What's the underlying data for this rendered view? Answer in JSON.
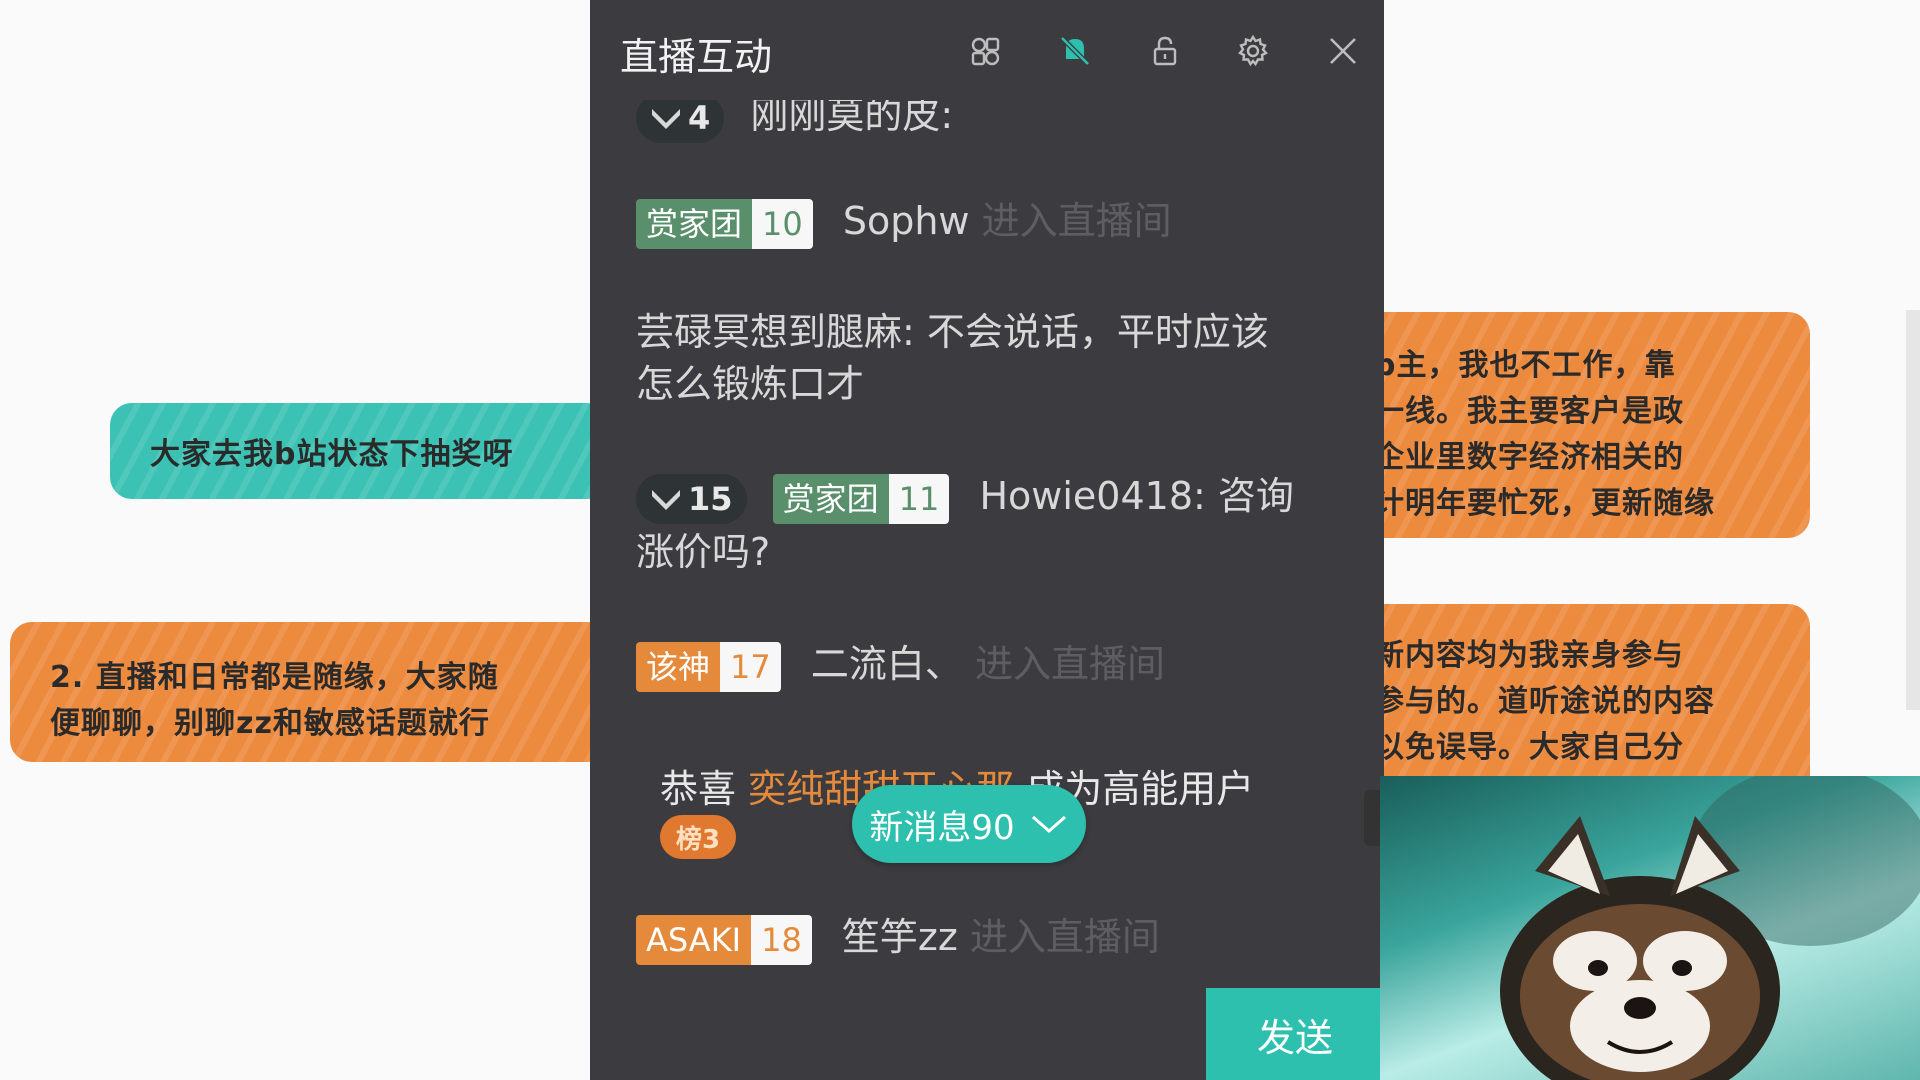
{
  "panel": {
    "title": "直播互动",
    "toolbar": [
      "layout-icon",
      "bell-off-icon",
      "lock-icon",
      "settings-icon",
      "close-icon"
    ],
    "messages": {
      "m0": {
        "fan_level": "4",
        "text": "刚刚莫的皮:"
      },
      "m1": {
        "badge_name": "赏家团",
        "badge_level": "10",
        "user": "Sophw",
        "action": "进入直播间"
      },
      "m2": {
        "line1": "芸碌冥想到腿麻: 不会说话，平时应该",
        "line2": "怎么锻炼口才"
      },
      "m3": {
        "fan_level": "15",
        "badge_name": "赏家团",
        "badge_level": "11",
        "line1": "Howie0418: 咨询",
        "line2": "涨价吗?"
      },
      "m4": {
        "badge_name": "该神",
        "badge_level": "17",
        "user": "二流白、",
        "action": "进入直播间"
      },
      "m5": {
        "prefix": "恭喜",
        "user": "奕纯甜甜开心那",
        "suffix": "成为高能用户",
        "tag": "榜3"
      },
      "m6": {
        "badge_name": "ASAKI",
        "badge_level": "18",
        "user": "笙竽zz",
        "action": "进入直播间"
      }
    },
    "new_messages_label": "新消息90",
    "send_label": "发送"
  },
  "background_cards": {
    "teal": {
      "text": "大家去我b站状态下抽奖呀"
    },
    "orange_left": {
      "line1": "2. 直播和日常都是随缘，大家随",
      "line2": "便聊聊，别聊zz和敏感话题就行"
    },
    "orange_right_top": {
      "line1": "p主，我也不工作，靠",
      "line2": "一线。我主要客户是政",
      "line3": "企业里数字经济相关的",
      "line4": "计明年要忙死，更新随缘"
    },
    "orange_right_bottom": {
      "line1": "新内容均为我亲身参与",
      "line2": "参与的。道听途说的内容",
      "line3": "以免误导。大家自己分"
    }
  },
  "colors": {
    "panel_bg": "#3c3c40",
    "accent_teal": "#2ec0ae",
    "badge_green": "#5a8f6b",
    "badge_orange": "#e58a3b",
    "card_orange": "#ec8a3e",
    "card_teal": "#3cc2b4"
  }
}
